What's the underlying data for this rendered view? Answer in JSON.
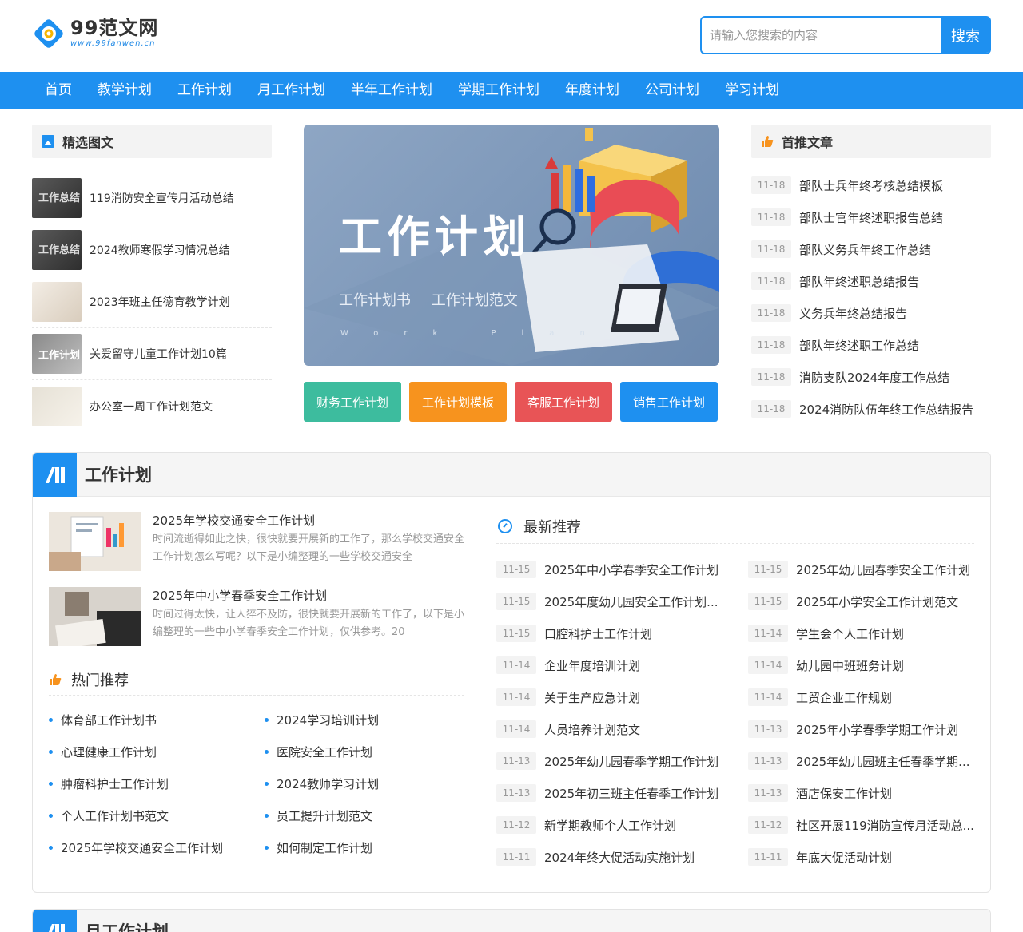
{
  "header": {
    "logo_name": "99范文网",
    "logo_url": "www.99fanwen.cn",
    "search_placeholder": "请输入您搜索的内容",
    "search_button": "搜索"
  },
  "nav": [
    "首页",
    "教学计划",
    "工作计划",
    "月工作计划",
    "半年工作计划",
    "学期工作计划",
    "年度计划",
    "公司计划",
    "学习计划"
  ],
  "featured": {
    "title": "精选图文",
    "items": [
      {
        "title": "119消防安全宣传月活动总结",
        "thumb_text": "工作总结"
      },
      {
        "title": "2024教师寒假学习情况总结",
        "thumb_text": "工作总结"
      },
      {
        "title": "2023年班主任德育教学计划",
        "thumb_text": ""
      },
      {
        "title": "关爱留守儿童工作计划10篇",
        "thumb_text": "工作计划"
      },
      {
        "title": "办公室一周工作计划范文",
        "thumb_text": ""
      }
    ]
  },
  "banner": {
    "title": "工作计划",
    "subtitle": "工作计划书 工作计划范文",
    "small": "Work Plan"
  },
  "quick_buttons": [
    {
      "label": "财务工作计划",
      "color": "#3dbc9e"
    },
    {
      "label": "工作计划模板",
      "color": "#f7931e"
    },
    {
      "label": "客服工作计划",
      "color": "#e85456"
    },
    {
      "label": "销售工作计划",
      "color": "#1e90f0"
    }
  ],
  "recommend": {
    "title": "首推文章",
    "items": [
      {
        "date": "11-18",
        "title": "部队士兵年终考核总结模板"
      },
      {
        "date": "11-18",
        "title": "部队士官年终述职报告总结"
      },
      {
        "date": "11-18",
        "title": "部队义务兵年终工作总结"
      },
      {
        "date": "11-18",
        "title": "部队年终述职总结报告"
      },
      {
        "date": "11-18",
        "title": "义务兵年终总结报告"
      },
      {
        "date": "11-18",
        "title": "部队年终述职工作总结"
      },
      {
        "date": "11-18",
        "title": "消防支队2024年度工作总结"
      },
      {
        "date": "11-18",
        "title": "2024消防队伍年终工作总结报告"
      }
    ]
  },
  "section": {
    "title": "工作计划",
    "articles": [
      {
        "title": "2025年学校交通安全工作计划",
        "desc": "时间流逝得如此之快，很快就要开展新的工作了，那么学校交通安全工作计划怎么写呢？以下是小编整理的一些学校交通安全"
      },
      {
        "title": "2025年中小学春季安全工作计划",
        "desc": "时间过得太快，让人猝不及防，很快就要开展新的工作了，以下是小编整理的一些中小学春季安全工作计划，仅供参考。20"
      }
    ],
    "hot": {
      "title": "热门推荐",
      "items": [
        "体育部工作计划书",
        "2024学习培训计划",
        "心理健康工作计划",
        "医院安全工作计划",
        "肿瘤科护士工作计划",
        "2024教师学习计划",
        "个人工作计划书范文",
        "员工提升计划范文",
        "2025年学校交通安全工作计划",
        "如何制定工作计划"
      ]
    },
    "latest": {
      "title": "最新推荐",
      "items": [
        {
          "date": "11-15",
          "title": "2025年中小学春季安全工作计划"
        },
        {
          "date": "11-15",
          "title": "2025年幼儿园春季安全工作计划"
        },
        {
          "date": "11-15",
          "title": "2025年度幼儿园安全工作计划..."
        },
        {
          "date": "11-15",
          "title": "2025年小学安全工作计划范文"
        },
        {
          "date": "11-15",
          "title": "口腔科护士工作计划"
        },
        {
          "date": "11-14",
          "title": "学生会个人工作计划"
        },
        {
          "date": "11-14",
          "title": "企业年度培训计划"
        },
        {
          "date": "11-14",
          "title": "幼儿园中班班务计划"
        },
        {
          "date": "11-14",
          "title": "关于生产应急计划"
        },
        {
          "date": "11-14",
          "title": "工贸企业工作规划"
        },
        {
          "date": "11-14",
          "title": "人员培养计划范文"
        },
        {
          "date": "11-13",
          "title": "2025年小学春季学期工作计划"
        },
        {
          "date": "11-13",
          "title": "2025年幼儿园春季学期工作计划"
        },
        {
          "date": "11-13",
          "title": "2025年幼儿园班主任春季学期..."
        },
        {
          "date": "11-13",
          "title": "2025年初三班主任春季工作计划"
        },
        {
          "date": "11-13",
          "title": "酒店保安工作计划"
        },
        {
          "date": "11-12",
          "title": "新学期教师个人工作计划"
        },
        {
          "date": "11-12",
          "title": "社区开展119消防宣传月活动总..."
        },
        {
          "date": "11-11",
          "title": "2024年终大促活动实施计划"
        },
        {
          "date": "11-11",
          "title": "年底大促活动计划"
        }
      ]
    }
  },
  "section2": {
    "title": "月工作计划"
  }
}
